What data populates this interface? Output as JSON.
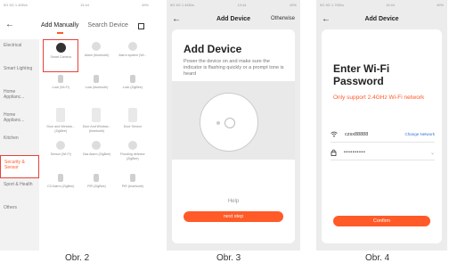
{
  "screen1": {
    "status_left": "5G 5G 1.4KB/s",
    "status_time": "13:44",
    "status_right": "49%",
    "tab_active": "Add Manually",
    "tab_other": "Search Device",
    "sidebar": [
      "Electrical",
      "Smart Lighting",
      "Home Applianc...",
      "Home Applianc...",
      "Kitchen",
      "Security & Sensor",
      "Sport & Health",
      "Others"
    ],
    "devices": [
      {
        "label": "Smart Camera",
        "icon": "camera-icon"
      },
      {
        "label": "Alarm (bluetooth)",
        "icon": "alarm-icon"
      },
      {
        "label": "Alarm system (Wi...",
        "icon": "alarm-system-icon"
      },
      {
        "label": "Lock (Wi-Fi)",
        "icon": "lock-icon"
      },
      {
        "label": "Lock (bluetooth)",
        "icon": "lock-icon"
      },
      {
        "label": "Lock (ZigBee)",
        "icon": "lock-icon"
      },
      {
        "label": "Door and Window... (ZigBee)",
        "icon": "door-sensor-icon"
      },
      {
        "label": "Door And Window... (bluetooth)",
        "icon": "door-sensor-icon"
      },
      {
        "label": "Door Sensor",
        "icon": "door-sensor-icon"
      },
      {
        "label": "Sensor (Wi-Fi)",
        "icon": "sensor-icon"
      },
      {
        "label": "Gas Alarm (ZigBee)",
        "icon": "gas-alarm-icon"
      },
      {
        "label": "Flooding detector (ZigBee)",
        "icon": "flood-icon"
      },
      {
        "label": "CO Alarm (ZigBee)",
        "icon": "co-alarm-icon"
      },
      {
        "label": "PIR (ZigBee)",
        "icon": "pir-icon"
      },
      {
        "label": "PIR (bluetooth)",
        "icon": "pir-icon"
      }
    ]
  },
  "screen2": {
    "status_left": "5G 5G 1.4KB/s",
    "status_time": "13:44",
    "status_right": "49%",
    "title": "Add Device",
    "nav_right": "Otherwise",
    "card_title": "Add Device",
    "card_desc": "Power the device on and make sure the indicator is flashing quickly or a prompt tone is heard",
    "help": "Help",
    "button": "next step"
  },
  "screen3": {
    "status_left": "5G 5G 1.7KB/s",
    "status_time": "13:44",
    "status_right": "49%",
    "title": "Add Device",
    "card_title": "Enter Wi-Fi Password",
    "note": "Only support 2.4GHz Wi-Fi network",
    "ssid": "czsx88888",
    "change": "Change Network",
    "password": "••••••••••",
    "button": "Confirm"
  },
  "captions": [
    "Obr. 2",
    "Obr. 3",
    "Obr. 4"
  ],
  "colors": {
    "accent": "#ff5a28",
    "link": "#2f78d5",
    "highlight": "#e8413a"
  }
}
